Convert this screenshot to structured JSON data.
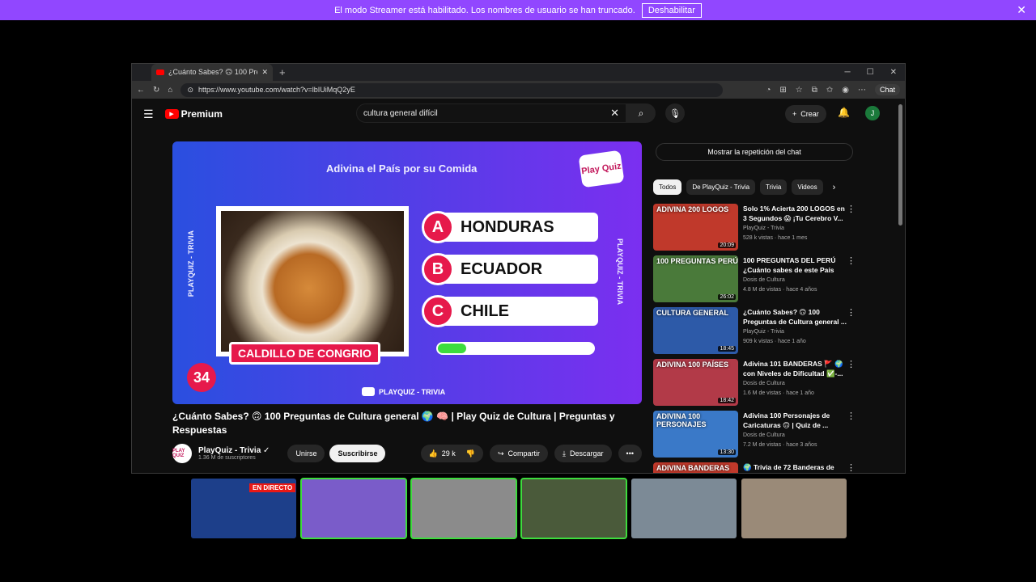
{
  "banner": {
    "message": "El modo Streamer está habilitado. Los nombres de usuario se han truncado.",
    "action": "Deshabilitar",
    "close": "✕"
  },
  "browser": {
    "tab_title": "¿Cuánto Sabes? 🙃 100 Pregunta",
    "tab_close": "✕",
    "new_tab": "+",
    "url": "https://www.youtube.com/watch?v=lbIUiMqQ2yE",
    "chat_label": "Chat"
  },
  "youtube": {
    "logo_text": "Premium",
    "search_value": "cultura general difícil",
    "create_label": "Crear",
    "avatar_letter": "J"
  },
  "video_frame": {
    "question": "Adivina el País por su Comida",
    "brand_logo": "Play Quiz",
    "side_text": "PLAYQUIZ - TRIVIA",
    "food_label": "CALDILLO DE CONGRIO",
    "question_number": "34",
    "options": [
      {
        "letter": "A",
        "text": "HONDURAS"
      },
      {
        "letter": "B",
        "text": "ECUADOR"
      },
      {
        "letter": "C",
        "text": "CHILE"
      }
    ],
    "timer_fraction": 0.18,
    "bottom_brand": "PLAYQUIZ - TRIVIA"
  },
  "video": {
    "title": "¿Cuánto Sabes? 🙃 100 Preguntas de Cultura general 🌍 🧠 | Play Quiz de Cultura | Preguntas y Respuestas",
    "channel": "PlayQuiz - Trivia",
    "subscribers": "1.36 M de suscriptores",
    "join": "Unirse",
    "subscribe": "Suscribirse",
    "likes": "29 k",
    "share": "Compartir",
    "download": "Descargar",
    "more": "•••"
  },
  "sidebar": {
    "chat_replay": "Mostrar la repetición del chat",
    "chips": [
      "Todos",
      "De PlayQuiz - Trivia",
      "Trivia",
      "Videos"
    ],
    "recommendations": [
      {
        "thumb_label": "ADIVINA 200 LOGOS",
        "duration": "20:09",
        "title": "Solo 1% Acierta 200 LOGOS en 3 Segundos 😱 ¡Tu Cerebro V...",
        "channel": "PlayQuiz - Trivia",
        "meta": "528 k vistas · hace 1 mes",
        "color": "#c0392b"
      },
      {
        "thumb_label": "100 PREGUNTAS PERÚ",
        "duration": "26:02",
        "title": "100 PREGUNTAS DEL PERÚ ¿Cuánto sabes de este País 🤔?",
        "channel": "Dosis de Cultura",
        "meta": "4.8 M de vistas · hace 4 años",
        "color": "#4a7a3a"
      },
      {
        "thumb_label": "CULTURA GENERAL",
        "duration": "18:45",
        "title": "¿Cuánto Sabes? 🙃 100 Preguntas de Cultura general ...",
        "channel": "PlayQuiz - Trivia",
        "meta": "909 k vistas · hace 1 año",
        "color": "#2d5aa8"
      },
      {
        "thumb_label": "ADIVINA 100 PAÍSES",
        "duration": "18:42",
        "title": "Adivina 101 BANDERAS 🚩 🌍 con Niveles de Dificultad ✅-...",
        "channel": "Dosis de Cultura",
        "meta": "1.6 M de vistas · hace 1 año",
        "color": "#b23a48"
      },
      {
        "thumb_label": "ADIVINA 100 PERSONAJES",
        "duration": "13:30",
        "title": "Adivina 100 Personajes de Caricaturas 🙃 | Quiz de ...",
        "channel": "Dosis de Cultura",
        "meta": "7.2 M de vistas · hace 3 años",
        "color": "#3a79c8"
      },
      {
        "thumb_label": "ADIVINA BANDERAS",
        "duration": "",
        "title": "🌍 Trivia de 72 Banderas de",
        "channel": "",
        "meta": "",
        "color": "#c0392b"
      }
    ]
  },
  "participants": {
    "live_label": "EN DIRECTO",
    "tiles": [
      {
        "color": "#1d3f8a",
        "speaking": false,
        "label": ""
      },
      {
        "color": "#7a5cc9",
        "speaking": true,
        "label": ""
      },
      {
        "color": "#8b8b8b",
        "speaking": true,
        "label": ""
      },
      {
        "color": "#4a5a3a",
        "speaking": true,
        "label": ""
      },
      {
        "color": "#7c8a96",
        "speaking": false,
        "label": ""
      },
      {
        "color": "#9a8a78",
        "speaking": false,
        "label": ""
      }
    ]
  }
}
